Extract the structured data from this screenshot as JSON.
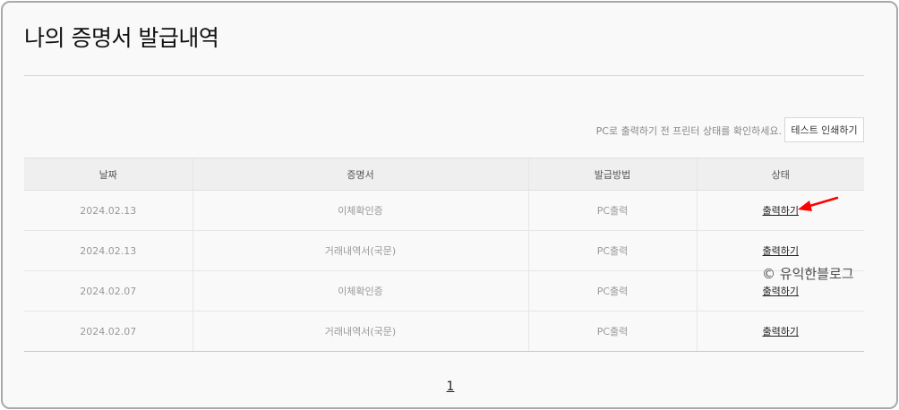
{
  "page": {
    "title": "나의 증명서 발급내역"
  },
  "toolbar": {
    "notice": "PC로 출력하기 전 프린터 상태를 확인하세요.",
    "test_print_label": "테스트 인쇄하기"
  },
  "table": {
    "headers": [
      "날짜",
      "증명서",
      "발급방법",
      "상태"
    ],
    "rows": [
      {
        "date": "2024.02.13",
        "certificate": "이체확인증",
        "method": "PC출력",
        "status": "출력하기"
      },
      {
        "date": "2024.02.13",
        "certificate": "거래내역서(국문)",
        "method": "PC출력",
        "status": "출력하기"
      },
      {
        "date": "2024.02.07",
        "certificate": "이체확인증",
        "method": "PC출력",
        "status": "출력하기"
      },
      {
        "date": "2024.02.07",
        "certificate": "거래내역서(국문)",
        "method": "PC출력",
        "status": "출력하기"
      }
    ]
  },
  "pagination": {
    "current": "1"
  },
  "watermark": {
    "text": "© 유익한블로그"
  },
  "colors": {
    "arrow": "#ff0000",
    "header_bg": "#efefef",
    "frame_border": "#a9a9a9"
  },
  "icons": {
    "arrow": "red-arrow-icon"
  }
}
